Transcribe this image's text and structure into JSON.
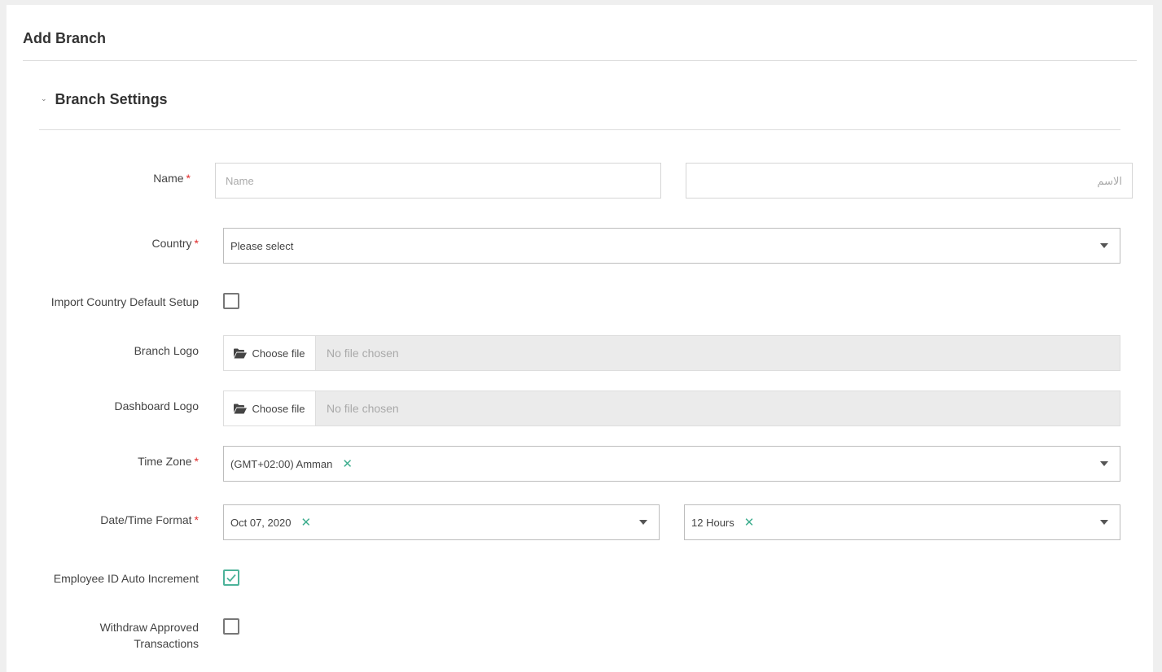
{
  "page": {
    "title": "Add Branch",
    "section_title": "Branch Settings"
  },
  "form": {
    "required_mark": "*",
    "name": {
      "label": "Name",
      "en_placeholder": "Name",
      "ar_placeholder": "الاسم"
    },
    "country": {
      "label": "Country",
      "value": "Please select"
    },
    "import_default": {
      "label": "Import Country Default Setup",
      "checked": false
    },
    "branch_logo": {
      "label": "Branch Logo",
      "button": "Choose file",
      "status": "No file chosen"
    },
    "dashboard_logo": {
      "label": "Dashboard Logo",
      "button": "Choose file",
      "status": "No file chosen"
    },
    "time_zone": {
      "label": "Time Zone",
      "value": "(GMT+02:00) Amman",
      "clear": "✕"
    },
    "datetime_format": {
      "label": "Date/Time Format",
      "date_value": "Oct 07, 2020",
      "time_value": "12 Hours",
      "clear": "✕"
    },
    "employee_id_auto_increment": {
      "label": "Employee ID Auto Increment",
      "checked": true
    },
    "withdraw_approved": {
      "label_line1": "Withdraw Approved",
      "label_line2": "Transactions",
      "checked": false
    }
  },
  "icons": {
    "section_toggle": "chevron-down-icon",
    "file_button": "folder-open-icon",
    "select_caret": "caret-down-icon",
    "check": "check-icon"
  },
  "colors": {
    "required": "#e02b2b",
    "accent": "#4db39a",
    "clear_icon": "#3fae8f"
  }
}
